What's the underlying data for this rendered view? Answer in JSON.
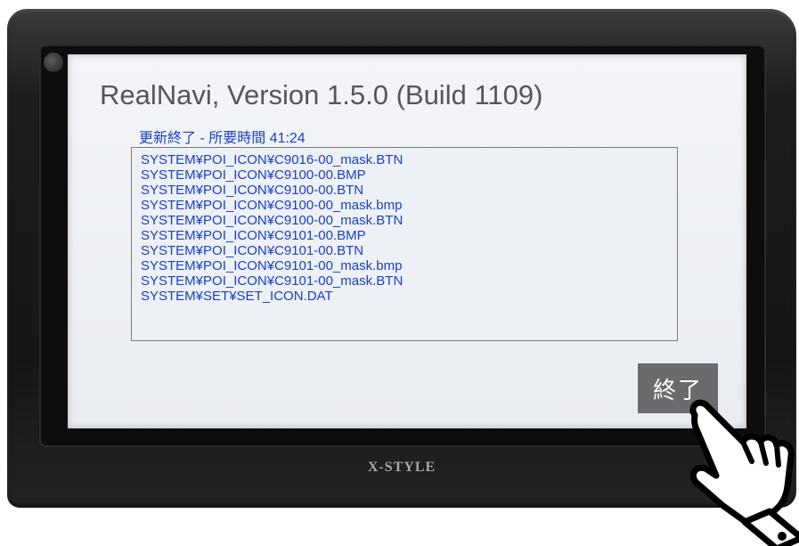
{
  "app": {
    "title": "RealNavi, Version 1.5.0 (Build 1109)",
    "status": "更新終了 - 所要時間 41:24"
  },
  "log": {
    "lines": [
      "SYSTEM¥POI_ICON¥C9016-00_mask.BTN",
      "SYSTEM¥POI_ICON¥C9100-00.BMP",
      "SYSTEM¥POI_ICON¥C9100-00.BTN",
      "SYSTEM¥POI_ICON¥C9100-00_mask.bmp",
      "SYSTEM¥POI_ICON¥C9100-00_mask.BTN",
      "SYSTEM¥POI_ICON¥C9101-00.BMP",
      "SYSTEM¥POI_ICON¥C9101-00.BTN",
      "SYSTEM¥POI_ICON¥C9101-00_mask.bmp",
      "SYSTEM¥POI_ICON¥C9101-00_mask.BTN",
      "SYSTEM¥SET¥SET_ICON.DAT"
    ]
  },
  "buttons": {
    "end_label": "終了"
  },
  "device": {
    "brand": "X-STYLE"
  },
  "icons": {
    "pointer": "pointing-hand-icon"
  },
  "colors": {
    "text_blue": "#1a3fc6",
    "button_gray": "#6b6b6e",
    "screen_bg": "#eef1f5"
  }
}
